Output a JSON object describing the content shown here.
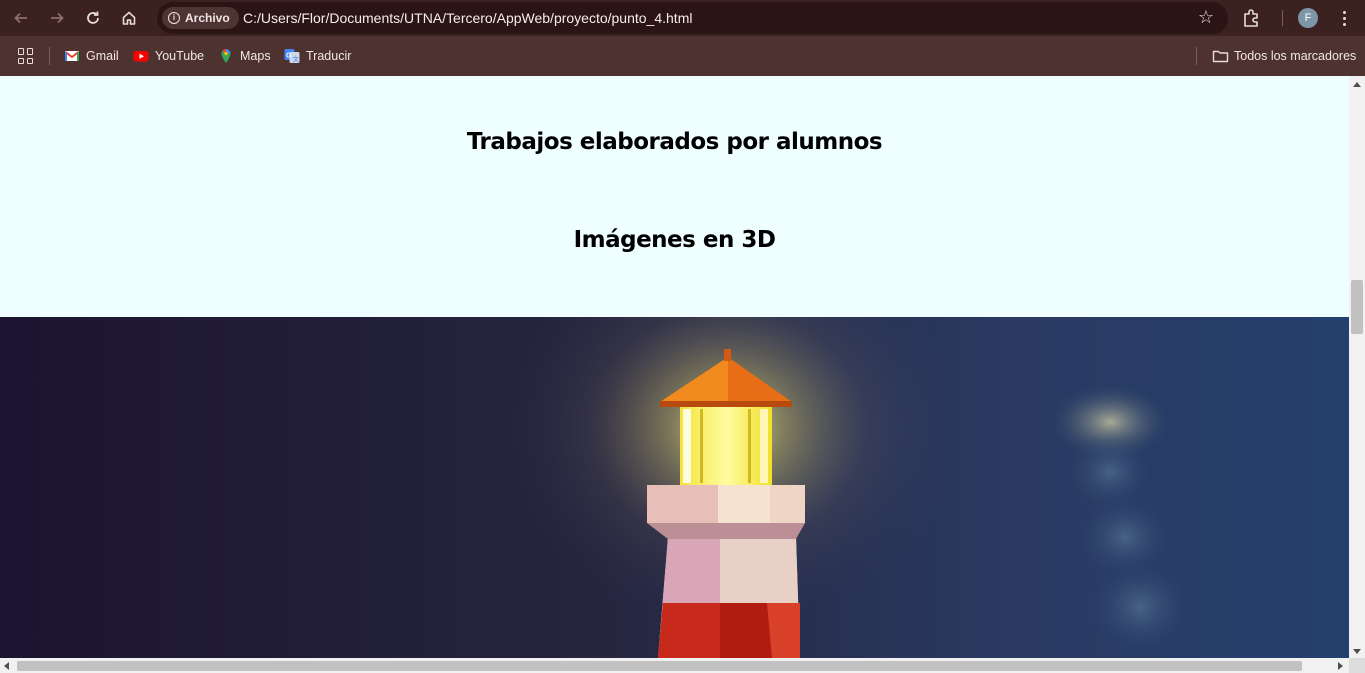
{
  "browser": {
    "address_chip": "Archivo",
    "url": "C:/Users/Flor/Documents/UTNA/Tercero/AppWeb/proyecto/punto_4.html",
    "profile_initial": "F",
    "bookmarks": [
      {
        "label": "Gmail",
        "icon": "gmail-icon"
      },
      {
        "label": "YouTube",
        "icon": "youtube-icon"
      },
      {
        "label": "Maps",
        "icon": "maps-icon"
      },
      {
        "label": "Traducir",
        "icon": "translate-icon"
      }
    ],
    "all_bookmarks_label": "Todos los marcadores"
  },
  "page": {
    "heading_1": "Trabajos elaborados por alumnos",
    "heading_2": "Imágenes en 3D",
    "background_color": "#efffff",
    "image_subject": "lighthouse-3d-image"
  }
}
